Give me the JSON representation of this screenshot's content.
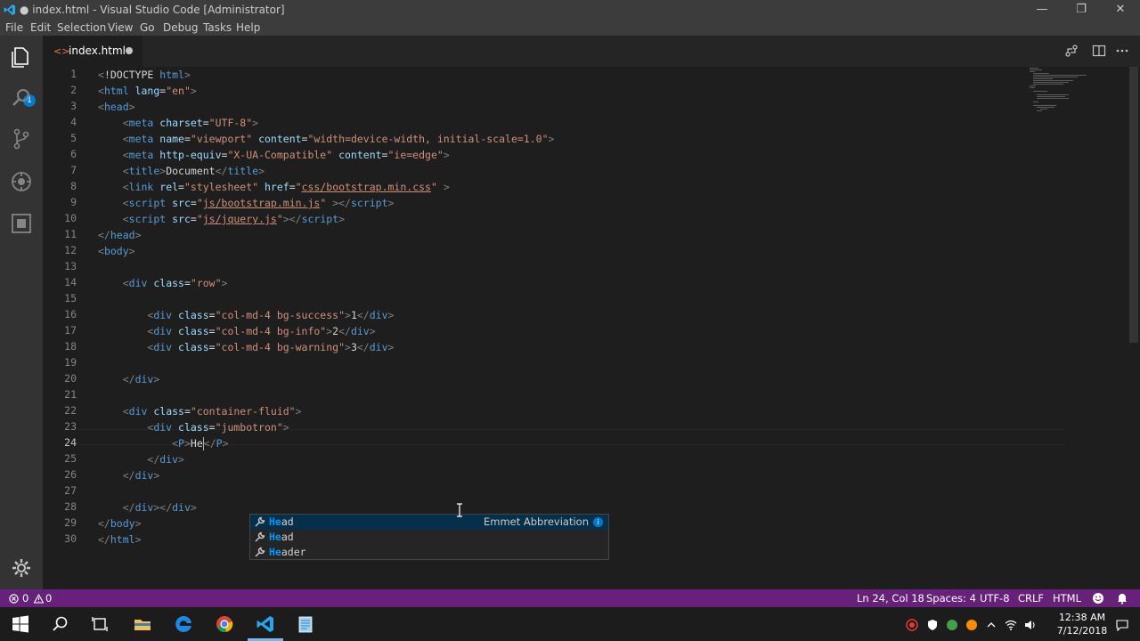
{
  "window": {
    "title": "● index.html - Visual Studio Code [Administrator]",
    "minimize": "—",
    "restore": "❐",
    "close": "✕"
  },
  "menu": [
    "File",
    "Edit",
    "Selection",
    "View",
    "Go",
    "Debug",
    "Tasks",
    "Help"
  ],
  "activity": {
    "badge": "1"
  },
  "tab": {
    "label": "index.html",
    "icon": "<>"
  },
  "editor": {
    "line_numbers": [
      "1",
      "2",
      "3",
      "4",
      "5",
      "6",
      "7",
      "8",
      "9",
      "10",
      "11",
      "12",
      "13",
      "14",
      "15",
      "16",
      "17",
      "18",
      "19",
      "20",
      "21",
      "22",
      "23",
      "24",
      "25",
      "26",
      "27",
      "28",
      "29",
      "30"
    ],
    "current_line": 24,
    "lines": [
      [
        [
          "br",
          "<"
        ],
        [
          "txt",
          "!DOCTYPE "
        ],
        [
          "tag",
          "html"
        ],
        [
          "br",
          ">"
        ]
      ],
      [
        [
          "br",
          "<"
        ],
        [
          "tag",
          "html "
        ],
        [
          "attr",
          "lang"
        ],
        [
          "txt",
          "="
        ],
        [
          "str",
          "\"en\""
        ],
        [
          "br",
          ">"
        ]
      ],
      [
        [
          "br",
          "<"
        ],
        [
          "tag",
          "head"
        ],
        [
          "br",
          ">"
        ]
      ],
      [
        [
          "txt",
          "    "
        ],
        [
          "br",
          "<"
        ],
        [
          "tag",
          "meta "
        ],
        [
          "attr",
          "charset"
        ],
        [
          "txt",
          "="
        ],
        [
          "str",
          "\"UTF-8\""
        ],
        [
          "br",
          ">"
        ]
      ],
      [
        [
          "txt",
          "    "
        ],
        [
          "br",
          "<"
        ],
        [
          "tag",
          "meta "
        ],
        [
          "attr",
          "name"
        ],
        [
          "txt",
          "="
        ],
        [
          "str",
          "\"viewport\" "
        ],
        [
          "attr",
          "content"
        ],
        [
          "txt",
          "="
        ],
        [
          "str",
          "\"width=device-width, initial-scale=1.0\""
        ],
        [
          "br",
          ">"
        ]
      ],
      [
        [
          "txt",
          "    "
        ],
        [
          "br",
          "<"
        ],
        [
          "tag",
          "meta "
        ],
        [
          "attr",
          "http-equiv"
        ],
        [
          "txt",
          "="
        ],
        [
          "str",
          "\"X-UA-Compatible\" "
        ],
        [
          "attr",
          "content"
        ],
        [
          "txt",
          "="
        ],
        [
          "str",
          "\"ie=edge\""
        ],
        [
          "br",
          ">"
        ]
      ],
      [
        [
          "txt",
          "    "
        ],
        [
          "br",
          "<"
        ],
        [
          "tag",
          "title"
        ],
        [
          "br",
          ">"
        ],
        [
          "txt",
          "Document"
        ],
        [
          "br",
          "</"
        ],
        [
          "tag",
          "title"
        ],
        [
          "br",
          ">"
        ]
      ],
      [
        [
          "txt",
          "    "
        ],
        [
          "br",
          "<"
        ],
        [
          "tag",
          "link "
        ],
        [
          "attr",
          "rel"
        ],
        [
          "txt",
          "="
        ],
        [
          "str",
          "\"stylesheet\" "
        ],
        [
          "attr",
          "href"
        ],
        [
          "txt",
          "="
        ],
        [
          "str",
          "\""
        ],
        [
          "link",
          "css/bootstrap.min.css"
        ],
        [
          "str",
          "\" "
        ],
        [
          "br",
          ">"
        ]
      ],
      [
        [
          "txt",
          "    "
        ],
        [
          "br",
          "<"
        ],
        [
          "tag",
          "script "
        ],
        [
          "attr",
          "src"
        ],
        [
          "txt",
          "="
        ],
        [
          "str",
          "\""
        ],
        [
          "link",
          "js/bootstrap.min.js"
        ],
        [
          "str",
          "\" "
        ],
        [
          "br",
          "></"
        ],
        [
          "tag",
          "script"
        ],
        [
          "br",
          ">"
        ]
      ],
      [
        [
          "txt",
          "    "
        ],
        [
          "br",
          "<"
        ],
        [
          "tag",
          "script "
        ],
        [
          "attr",
          "src"
        ],
        [
          "txt",
          "="
        ],
        [
          "str",
          "\""
        ],
        [
          "link",
          "js/jquery.js"
        ],
        [
          "str",
          "\""
        ],
        [
          "br",
          "></"
        ],
        [
          "tag",
          "script"
        ],
        [
          "br",
          ">"
        ]
      ],
      [
        [
          "br",
          "</"
        ],
        [
          "tag",
          "head"
        ],
        [
          "br",
          ">"
        ]
      ],
      [
        [
          "br",
          "<"
        ],
        [
          "tag",
          "body"
        ],
        [
          "br",
          ">"
        ]
      ],
      [],
      [
        [
          "txt",
          "    "
        ],
        [
          "br",
          "<"
        ],
        [
          "tag",
          "div "
        ],
        [
          "attr",
          "class"
        ],
        [
          "txt",
          "="
        ],
        [
          "str",
          "\"row\""
        ],
        [
          "br",
          ">"
        ]
      ],
      [],
      [
        [
          "txt",
          "        "
        ],
        [
          "br",
          "<"
        ],
        [
          "tag",
          "div "
        ],
        [
          "attr",
          "class"
        ],
        [
          "txt",
          "="
        ],
        [
          "str",
          "\"col-md-4 bg-success\""
        ],
        [
          "br",
          ">"
        ],
        [
          "txt",
          "1"
        ],
        [
          "br",
          "</"
        ],
        [
          "tag",
          "div"
        ],
        [
          "br",
          ">"
        ]
      ],
      [
        [
          "txt",
          "        "
        ],
        [
          "br",
          "<"
        ],
        [
          "tag",
          "div "
        ],
        [
          "attr",
          "class"
        ],
        [
          "txt",
          "="
        ],
        [
          "str",
          "\"col-md-4 bg-info\""
        ],
        [
          "br",
          ">"
        ],
        [
          "txt",
          "2"
        ],
        [
          "br",
          "</"
        ],
        [
          "tag",
          "div"
        ],
        [
          "br",
          ">"
        ]
      ],
      [
        [
          "txt",
          "        "
        ],
        [
          "br",
          "<"
        ],
        [
          "tag",
          "div "
        ],
        [
          "attr",
          "class"
        ],
        [
          "txt",
          "="
        ],
        [
          "str",
          "\"col-md-4 bg-warning\""
        ],
        [
          "br",
          ">"
        ],
        [
          "txt",
          "3"
        ],
        [
          "br",
          "</"
        ],
        [
          "tag",
          "div"
        ],
        [
          "br",
          ">"
        ]
      ],
      [],
      [
        [
          "txt",
          "    "
        ],
        [
          "br",
          "</"
        ],
        [
          "tag",
          "div"
        ],
        [
          "br",
          ">"
        ]
      ],
      [],
      [
        [
          "txt",
          "    "
        ],
        [
          "br",
          "<"
        ],
        [
          "tag",
          "div "
        ],
        [
          "attr",
          "class"
        ],
        [
          "txt",
          "="
        ],
        [
          "str",
          "\"container-fluid\""
        ],
        [
          "br",
          ">"
        ]
      ],
      [
        [
          "txt",
          "        "
        ],
        [
          "br",
          "<"
        ],
        [
          "tag",
          "div "
        ],
        [
          "attr",
          "class"
        ],
        [
          "txt",
          "="
        ],
        [
          "str",
          "\"jumbotron\""
        ],
        [
          "br",
          ">"
        ]
      ],
      [
        [
          "txt",
          "            "
        ],
        [
          "br",
          "<"
        ],
        [
          "tag",
          "P"
        ],
        [
          "br",
          ">"
        ],
        [
          "txt",
          "He"
        ],
        [
          "caret",
          ""
        ],
        [
          "br",
          "</"
        ],
        [
          "tag",
          "P"
        ],
        [
          "br",
          ">"
        ]
      ],
      [
        [
          "txt",
          "        "
        ],
        [
          "br",
          "</"
        ],
        [
          "tag",
          "div"
        ],
        [
          "br",
          ">"
        ]
      ],
      [
        [
          "txt",
          "    "
        ],
        [
          "br",
          "</"
        ],
        [
          "tag",
          "div"
        ],
        [
          "br",
          ">"
        ]
      ],
      [],
      [
        [
          "txt",
          "    "
        ],
        [
          "br",
          "</"
        ],
        [
          "tag",
          "div"
        ],
        [
          "br",
          "></"
        ],
        [
          "tag",
          "div"
        ],
        [
          "br",
          ">"
        ]
      ],
      [
        [
          "br",
          "</"
        ],
        [
          "tag",
          "body"
        ],
        [
          "br",
          ">"
        ]
      ],
      [
        [
          "br",
          "</"
        ],
        [
          "tag",
          "html"
        ],
        [
          "br",
          ">"
        ]
      ]
    ]
  },
  "suggestions": {
    "match": "He",
    "detail": "Emmet Abbreviation",
    "items": [
      {
        "prefix": "He",
        "rest": "ad"
      },
      {
        "prefix": "He",
        "rest": "ad"
      },
      {
        "prefix": "He",
        "rest": "ader"
      }
    ]
  },
  "status": {
    "errors": "0",
    "warnings": "0",
    "position": "Ln 24, Col 18",
    "spaces": "Spaces: 4",
    "encoding": "UTF-8",
    "eol": "CRLF",
    "language": "HTML"
  },
  "taskbar": {
    "time": "12:38 AM",
    "date": "7/12/2018"
  },
  "colors": {
    "status_bar": "#68217a",
    "accent": "#007acc",
    "tag": "#569cd6",
    "attr": "#9cdcfe",
    "string": "#ce9178"
  }
}
